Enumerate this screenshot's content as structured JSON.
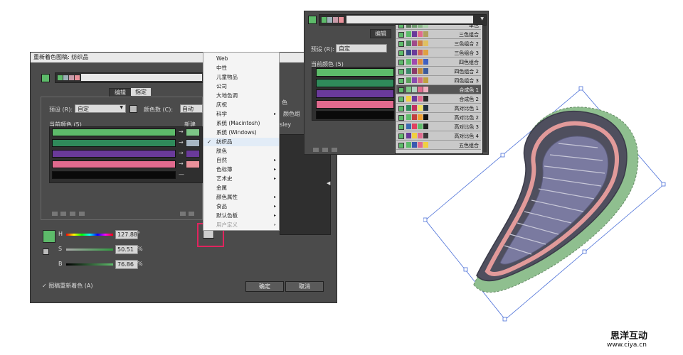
{
  "dialog": {
    "title": "重新着色图稿: 纺织品",
    "tabs": [
      {
        "label": "编辑"
      },
      {
        "label": "指定"
      }
    ],
    "preset_label": "预设 (R):",
    "preset_value": "自定",
    "color_count_label": "颜色数 (C):",
    "color_count_value": "自动",
    "current_colors_label": "当前颜色 (5)",
    "new_label": "新建",
    "current_colors": [
      "#5dbb6a",
      "#2f8a5a",
      "#6a3a9a",
      "#e16a8e",
      "#0a0a0a"
    ],
    "new_colors": [
      "#7cc686",
      "#a7b6c3",
      "#6a3a9a",
      "#e9919a"
    ],
    "side_labels": [
      "色",
      "颜色组",
      "sley"
    ],
    "sliders": [
      {
        "label": "H",
        "value": "127.88",
        "unit": "°"
      },
      {
        "label": "S",
        "value": "50.51",
        "unit": "%"
      },
      {
        "label": "B",
        "value": "76.86",
        "unit": "%"
      }
    ],
    "recolor_check": "✓ 图稿重新着色 (A)",
    "ok_label": "确定",
    "cancel_label": "取消"
  },
  "menu": {
    "items": [
      {
        "label": "Web",
        "sub": false
      },
      {
        "label": "中性",
        "sub": false
      },
      {
        "label": "儿童物品",
        "sub": false
      },
      {
        "label": "公司",
        "sub": false
      },
      {
        "label": "大地色调",
        "sub": false
      },
      {
        "label": "庆祝",
        "sub": false
      },
      {
        "label": "科学",
        "sub": true
      },
      {
        "label": "系统 (Macintosh)",
        "sub": false
      },
      {
        "label": "系统 (Windows)",
        "sub": false
      },
      {
        "label": "纺织品",
        "sub": false,
        "checked": true
      },
      {
        "label": "肤色",
        "sub": false
      },
      {
        "label": "自然",
        "sub": true
      },
      {
        "label": "色标簿",
        "sub": true
      },
      {
        "label": "艺术史",
        "sub": true
      },
      {
        "label": "金属",
        "sub": false
      },
      {
        "label": "颜色属性",
        "sub": true
      },
      {
        "label": "食品",
        "sub": true
      },
      {
        "label": "默认色板",
        "sub": true
      },
      {
        "label": "用户定义",
        "sub": true
      }
    ],
    "check_glyph": "✓",
    "sub_glyph": "▸"
  },
  "panel2": {
    "tab_label": "编辑",
    "preset_label": "预设 (R):",
    "preset_value": "自定",
    "current_colors_label": "当前颜色 (5)",
    "colors": [
      "#5dbb6a",
      "#2f8a5a",
      "#6a3a9a",
      "#e16a8e",
      "#0a0a0a"
    ],
    "harmony_rules": [
      {
        "label": "单色",
        "swatches": [
          "#5a7a5a",
          "#6f9a6f",
          "#86b486",
          "#a9d0a9"
        ]
      },
      {
        "label": "三色组合",
        "swatches": [
          "#5dbb6a",
          "#6a3a9a",
          "#e16a8e",
          "#b0a060"
        ]
      },
      {
        "label": "三色组合 2",
        "swatches": [
          "#4a8a5a",
          "#a04a8a",
          "#d08040",
          "#e0c060"
        ]
      },
      {
        "label": "三色组合 3",
        "swatches": [
          "#3a4a8a",
          "#6a3a9a",
          "#d06060",
          "#e0a040"
        ]
      },
      {
        "label": "四色组合",
        "swatches": [
          "#5dbb6a",
          "#a04ab0",
          "#e09040",
          "#4060c0"
        ]
      },
      {
        "label": "四色组合 2",
        "swatches": [
          "#3a8a6a",
          "#8a3a6a",
          "#c08a3a",
          "#3a5a9a"
        ]
      },
      {
        "label": "四色组合 3",
        "swatches": [
          "#5aa05a",
          "#8a4ab0",
          "#d06a8a",
          "#c0a040"
        ]
      },
      {
        "label": "合成色 1",
        "swatches": [
          "#7cc686",
          "#b0d0c0",
          "#e16a8e",
          "#f0b0c0"
        ]
      },
      {
        "label": "合成色 2",
        "swatches": [
          "#f0d040",
          "#6a3a9a",
          "#e16a8e",
          "#2a2a2a"
        ]
      },
      {
        "label": "高对比色 1",
        "swatches": [
          "#2f8a5a",
          "#c03060",
          "#f0e060",
          "#203040"
        ]
      },
      {
        "label": "高对比色 2",
        "swatches": [
          "#5dbb6a",
          "#c04040",
          "#f0a030",
          "#101010"
        ]
      },
      {
        "label": "高对比色 3",
        "swatches": [
          "#3a6ab0",
          "#e04060",
          "#5dbb6a",
          "#202020"
        ]
      },
      {
        "label": "高对比色 4",
        "swatches": [
          "#6a3a9a",
          "#f0d040",
          "#e16a8e",
          "#3a3a3a"
        ]
      },
      {
        "label": "五色组合",
        "swatches": [
          "#5dbb6a",
          "#3a5ab0",
          "#e16a8e",
          "#f0d040"
        ]
      }
    ],
    "selected_index": 7
  },
  "watermark": {
    "title": "思洋互动",
    "url": "www.ciya.cn"
  }
}
